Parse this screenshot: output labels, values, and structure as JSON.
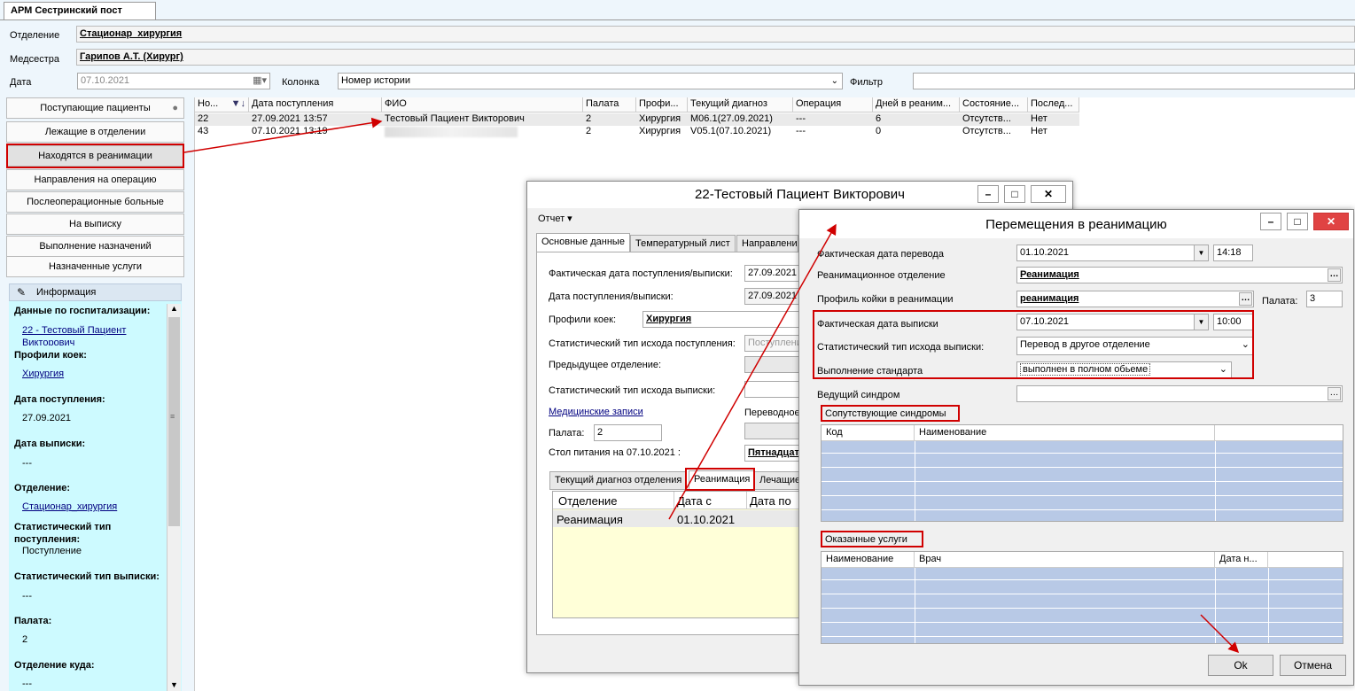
{
  "app": {
    "tab_title": "АРМ Сестринский пост"
  },
  "header": {
    "department_label": "Отделение",
    "department_value": "Стационар_хирургия",
    "nurse_label": "Медсестра",
    "nurse_value": "Гарипов А.Т. (Хирург)",
    "date_label": "Дата",
    "date_value": "07.10.2021",
    "column_label": "Колонка",
    "column_value": "Номер истории",
    "filter_label": "Фильтр",
    "filter_value": ""
  },
  "nav": [
    {
      "label": "Поступающие пациенты"
    },
    {
      "label": "Лежащие в отделении"
    },
    {
      "label": "Находятся в реанимации"
    },
    {
      "label": "Направления на операцию"
    },
    {
      "label": "Послеоперационные больные"
    },
    {
      "label": "На выписку"
    },
    {
      "label": "Выполнение назначений"
    },
    {
      "label": "Назначенные услуги"
    }
  ],
  "info": {
    "title": "Информация",
    "hosp_h": "Данные по госпитализации:",
    "hosp_v": "22 - Тестовый Пациент Викторович",
    "profile_h": "Профили коек:",
    "profile_v": "Хирургия",
    "adm_h": "Дата поступления:",
    "adm_v": "27.09.2021",
    "dis_h": "Дата выписки:",
    "dis_v": "---",
    "dep_h": "Отделение:",
    "dep_v": "Стационар_хирургия",
    "stat_in_h": "Статистический тип поступления:",
    "stat_in_v": "Поступление",
    "stat_out_h": "Статистический тип выписки:",
    "stat_out_v": "---",
    "ward_h": "Палата:",
    "ward_v": "2",
    "dest_h": "Отделение куда:",
    "dest_v": "---"
  },
  "grid": {
    "columns": [
      "Но...",
      "Дата поступления",
      "ФИО",
      "Палата",
      "Профи...",
      "Текущий диагноз",
      "Операция",
      "Дней в реаним...",
      "Состояние...",
      "Послед..."
    ],
    "rows": [
      [
        "22",
        "27.09.2021 13:57",
        "Тестовый Пациент Викторович",
        "2",
        "Хирургия",
        "М06.1(27.09.2021)",
        "---",
        "6",
        "Отсутств...",
        "Нет"
      ],
      [
        "43",
        "07.10.2021 13:19",
        "",
        "2",
        "Хирургия",
        "V05.1(07.10.2021)",
        "---",
        "0",
        "Отсутств...",
        "Нет"
      ]
    ]
  },
  "patient_window": {
    "title": "22-Тестовый Пациент Викторович",
    "menu_report": "Отчет ▾",
    "tabs": [
      "Основные данные",
      "Температурный лист",
      "Направления"
    ],
    "fact_date_label": "Фактическая дата поступления/выписки:",
    "fact_date_value": "27.09.2021",
    "date_label": "Дата поступления/выписки:",
    "date_value": "27.09.2021",
    "profile_label": "Профили коек:",
    "profile_value": "Хирургия",
    "stat_in_label": "Статистический тип исхода поступления:",
    "stat_in_value": "Поступлени",
    "prev_dep_label": "Предыдущее отделение:",
    "stat_out_label": "Статистический тип исхода выписки:",
    "med_records": "Медицинские записи",
    "transfer_label": "Переводное",
    "ward_label": "Палата:",
    "ward_value": "2",
    "diet_label": "Стол питания на 07.10.2021 :",
    "diet_value": "Пятнадцат",
    "subtabs": [
      "Текущий диагноз отделения",
      "Реанимация",
      "Лечащие"
    ],
    "reanim_cols": [
      "Отделение",
      "Дата с",
      "Дата по"
    ],
    "reanim_row": [
      "Реанимация",
      "01.10.2021",
      ""
    ]
  },
  "transfer_window": {
    "title": "Перемещения в реанимацию",
    "fact_transfer_label": "Фактическая дата перевода",
    "fact_transfer_date": "01.10.2021",
    "fact_transfer_time": "14:18",
    "reanim_dep_label": "Реанимационное отделение",
    "reanim_dep_value": "Реанимация",
    "bed_profile_label": "Профиль койки в реанимации",
    "bed_profile_value": "реанимация",
    "ward_label": "Палата:",
    "ward_value": "3",
    "fact_discharge_label": "Фактическая дата выписки",
    "fact_discharge_date": "07.10.2021",
    "fact_discharge_time": "10:00",
    "stat_out_label": "Статистический тип исхода выписки:",
    "stat_out_value": "Перевод в другое отделение",
    "standard_label": "Выполнение стандарта",
    "standard_value": "выполнен в полном обьеме",
    "lead_syndrome_label": "Ведущий синдром",
    "lead_syndrome_value": "",
    "concomitant_title": "Сопутствующие синдромы",
    "concomitant_cols": [
      "Код",
      "Наименование"
    ],
    "services_title": "Оказанные услуги",
    "services_cols": [
      "Наименование",
      "Врач",
      "Дата н..."
    ],
    "ok": "Ok",
    "cancel": "Отмена"
  },
  "colors": {
    "highlight": "#d00000",
    "grid_blue": "#b8c9e6",
    "info_bg": "#cdfaff"
  }
}
